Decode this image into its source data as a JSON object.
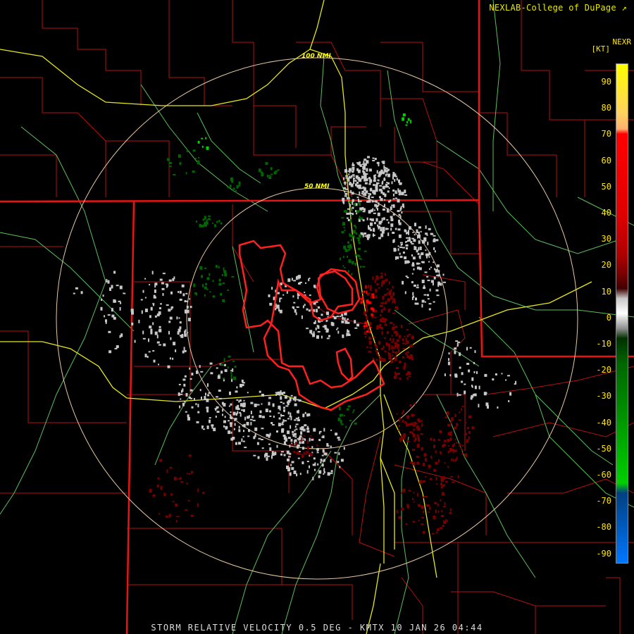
{
  "credit": "NEXLAB-College of DuPage",
  "credit_icon": "external-link-icon",
  "legend": {
    "product": "NEXR",
    "unit": "[KT]",
    "ticks": [
      "90",
      "80",
      "70",
      "60",
      "50",
      "40",
      "30",
      "20",
      "10",
      "0",
      "-10",
      "-20",
      "-30",
      "-40",
      "-50",
      "-60",
      "-70",
      "-80",
      "-90"
    ],
    "colors": {
      "strong_outbound": "#ffff00",
      "outbound": "#ff0000",
      "weak_outbound": "#7a0000",
      "near_zero": "#c8c8c8",
      "weak_inbound": "#006600",
      "inbound": "#00d000",
      "strong_inbound": "#0077ff"
    }
  },
  "range_rings": [
    "100 NMI",
    "50 NMI"
  ],
  "footer": "STORM RELATIVE VELOCITY 0.5 DEG - KMTX 10 JAN 26 04:44",
  "map_colors": {
    "state_border": "#ee1111",
    "county_border": "#c01010",
    "highway": "#e8e820",
    "road": "#66cc66",
    "range_ring": "#e8c8a0",
    "warning_polygon": "#ff2222"
  }
}
